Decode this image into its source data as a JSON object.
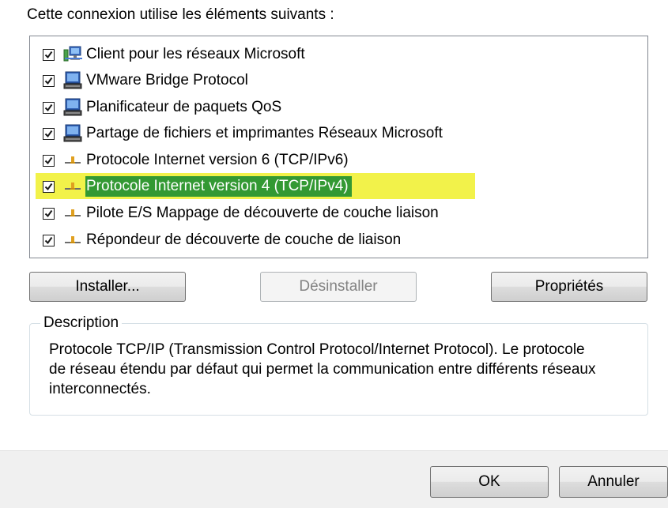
{
  "heading": "Cette connexion utilise les éléments suivants :",
  "items": [
    {
      "label": "Client pour les réseaux Microsoft",
      "icon": "network-client-icon",
      "checked": true
    },
    {
      "label": "VMware Bridge Protocol",
      "icon": "network-computer-icon",
      "checked": true
    },
    {
      "label": "Planificateur de paquets QoS",
      "icon": "network-computer-icon",
      "checked": true
    },
    {
      "label": "Partage de fichiers et imprimantes Réseaux Microsoft",
      "icon": "network-computer-icon",
      "checked": true
    },
    {
      "label": "Protocole Internet version 6 (TCP/IPv6)",
      "icon": "protocol-icon",
      "checked": true
    },
    {
      "label": "Protocole Internet version 4 (TCP/IPv4)",
      "icon": "protocol-icon",
      "checked": true,
      "selected": true
    },
    {
      "label": "Pilote E/S Mappage de découverte de couche liaison",
      "icon": "protocol-icon",
      "checked": true
    },
    {
      "label": "Répondeur de découverte de couche de liaison",
      "icon": "protocol-icon",
      "checked": true
    }
  ],
  "buttons": {
    "install": "Installer...",
    "uninstall": "Désinstaller",
    "properties": "Propriétés"
  },
  "description": {
    "label": "Description",
    "text": "Protocole TCP/IP (Transmission Control Protocol/Internet Protocol). Le protocole de réseau étendu par défaut qui permet la communication entre différents réseaux interconnectés."
  },
  "footer": {
    "ok": "OK",
    "cancel": "Annuler"
  },
  "colors": {
    "selection": "#339933",
    "highlight": "#f2f24a"
  }
}
